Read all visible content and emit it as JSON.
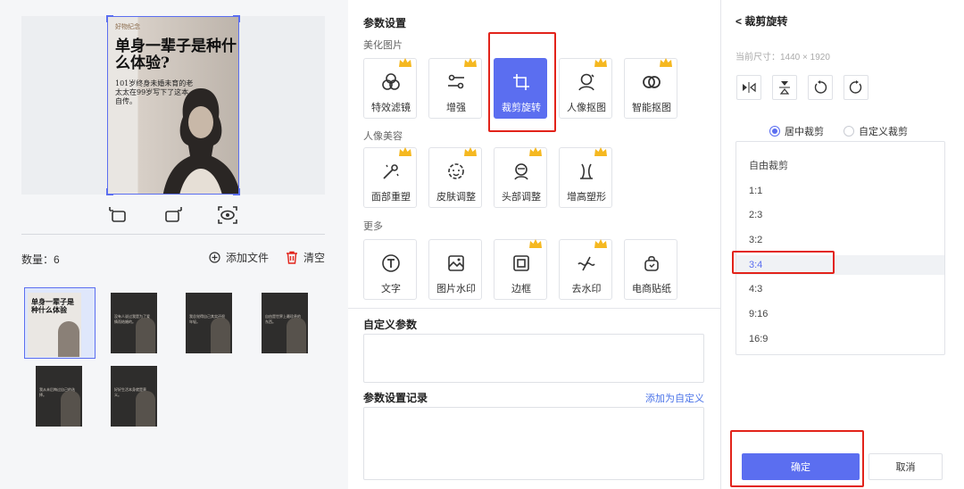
{
  "left": {
    "preview": {
      "small_title": "好物纪念",
      "title": "单身一辈子是种什么体验?",
      "subtitle": "101岁终身未婚未育的老太太在99岁写下了这本自传。"
    },
    "tool_icons": [
      "rotate-left-icon",
      "rotate-right-icon",
      "preview-eye-icon"
    ],
    "count_label": "数量：",
    "count_value": "6",
    "add_file_label": "添加文件",
    "clear_label": "清空",
    "selected_thumb_text": "单身一辈子是种什么体验",
    "thumbs": [
      {
        "text": "没有人说过我是为了爱情而结婚的。"
      },
      {
        "text": "我总觉得自己其实还很年轻。"
      },
      {
        "text": "自由是世界上最珍贵的东西。"
      },
      {
        "text": "我从未后悔过自己的选择。"
      },
      {
        "text": "好好生活本身就是意义。"
      }
    ]
  },
  "mid": {
    "title": "参数设置",
    "sections": [
      {
        "label": "美化图片",
        "buttons": [
          {
            "label": "特效滤镜",
            "icon": "filter-icon",
            "crown": true
          },
          {
            "label": "增强",
            "icon": "enhance-icon",
            "crown": true
          },
          {
            "label": "裁剪旋转",
            "icon": "crop-icon",
            "crown": false,
            "active": true
          },
          {
            "label": "人像抠图",
            "icon": "portrait-cutout-icon",
            "crown": true
          },
          {
            "label": "智能抠图",
            "icon": "smart-cutout-icon",
            "crown": true
          }
        ]
      },
      {
        "label": "人像美容",
        "buttons": [
          {
            "label": "面部重塑",
            "icon": "face-reshape-icon",
            "crown": true
          },
          {
            "label": "皮肤调整",
            "icon": "skin-adjust-icon",
            "crown": true
          },
          {
            "label": "头部调整",
            "icon": "head-adjust-icon",
            "crown": true
          },
          {
            "label": "增高塑形",
            "icon": "body-shape-icon",
            "crown": true
          }
        ]
      },
      {
        "label": "更多",
        "buttons": [
          {
            "label": "文字",
            "icon": "text-icon",
            "crown": false
          },
          {
            "label": "图片水印",
            "icon": "image-watermark-icon",
            "crown": false
          },
          {
            "label": "边框",
            "icon": "border-icon",
            "crown": true
          },
          {
            "label": "去水印",
            "icon": "remove-watermark-icon",
            "crown": true
          },
          {
            "label": "电商贴纸",
            "icon": "sticker-icon",
            "crown": false
          }
        ]
      }
    ],
    "custom_params_title": "自定义参数",
    "record_title": "参数设置记录",
    "add_custom_link": "添加为自定义"
  },
  "right": {
    "back_title": "< 裁剪旋转",
    "current_size": "当前尺寸：1440 × 1920",
    "rotate_buttons": [
      "flip-horizontal-icon",
      "flip-vertical-icon",
      "rotate-ccw-icon",
      "rotate-cw-icon"
    ],
    "crop_modes": [
      {
        "label": "居中裁剪",
        "selected": true
      },
      {
        "label": "自定义裁剪",
        "selected": false
      }
    ],
    "ratios": [
      "自由裁剪",
      "1:1",
      "2:3",
      "3:2",
      "3:4",
      "4:3",
      "9:16",
      "16:9"
    ],
    "selected_ratio": "3:4",
    "ok_label": "确定",
    "cancel_label": "取消"
  },
  "colors": {
    "accent": "#5b6ef0",
    "highlight_box": "#e2231a",
    "crown": "#f5b820"
  }
}
